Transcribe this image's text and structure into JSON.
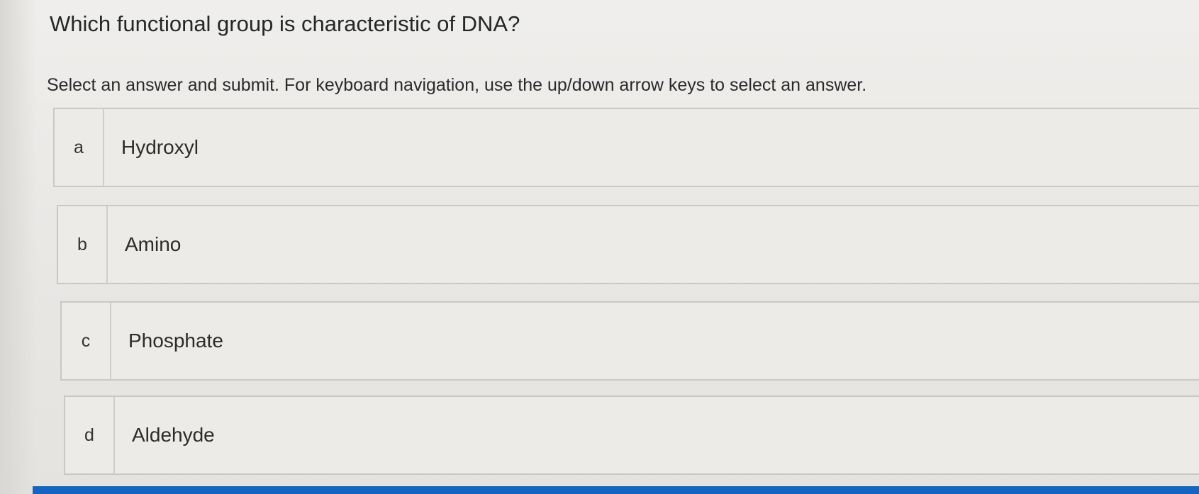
{
  "question": "Which functional group is characteristic of DNA?",
  "instructions": "Select an answer and submit. For keyboard navigation, use the up/down arrow keys to select an answer.",
  "options": [
    {
      "letter": "a",
      "label": "Hydroxyl"
    },
    {
      "letter": "b",
      "label": "Amino"
    },
    {
      "letter": "c",
      "label": "Phosphate"
    },
    {
      "letter": "d",
      "label": "Aldehyde"
    }
  ],
  "colors": {
    "background": "#ecebe8",
    "border": "#c9c8c5",
    "accent": "#1565c0"
  }
}
